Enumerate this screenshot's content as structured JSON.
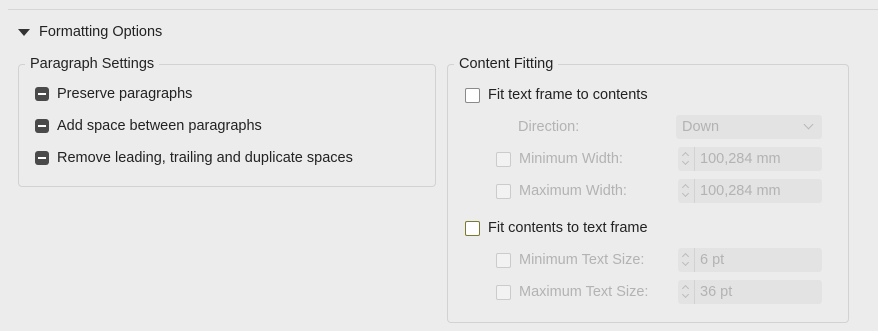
{
  "section": {
    "title": "Formatting Options"
  },
  "paragraph_settings": {
    "title": "Paragraph Settings",
    "options": [
      {
        "label": "Preserve paragraphs",
        "state": "mixed"
      },
      {
        "label": "Add space between paragraphs",
        "state": "mixed"
      },
      {
        "label": "Remove leading, trailing and duplicate spaces",
        "state": "mixed"
      }
    ]
  },
  "content_fitting": {
    "title": "Content Fitting",
    "fit_frame": {
      "label": "Fit text frame to contents",
      "checked": false,
      "direction_label": "Direction:",
      "direction_value": "Down",
      "min_width_label": "Minimum Width:",
      "min_width_value": "100,284 mm",
      "max_width_label": "Maximum Width:",
      "max_width_value": "100,284 mm"
    },
    "fit_contents": {
      "label": "Fit contents to text frame",
      "checked": false,
      "min_size_label": "Minimum Text Size:",
      "min_size_value": "6 pt",
      "max_size_label": "Maximum Text Size:",
      "max_size_value": "36 pt"
    }
  },
  "colors": {
    "background": "#ececec",
    "disabled_text": "#b3b3b3",
    "focus_checkbox": "#7c7a2c"
  }
}
